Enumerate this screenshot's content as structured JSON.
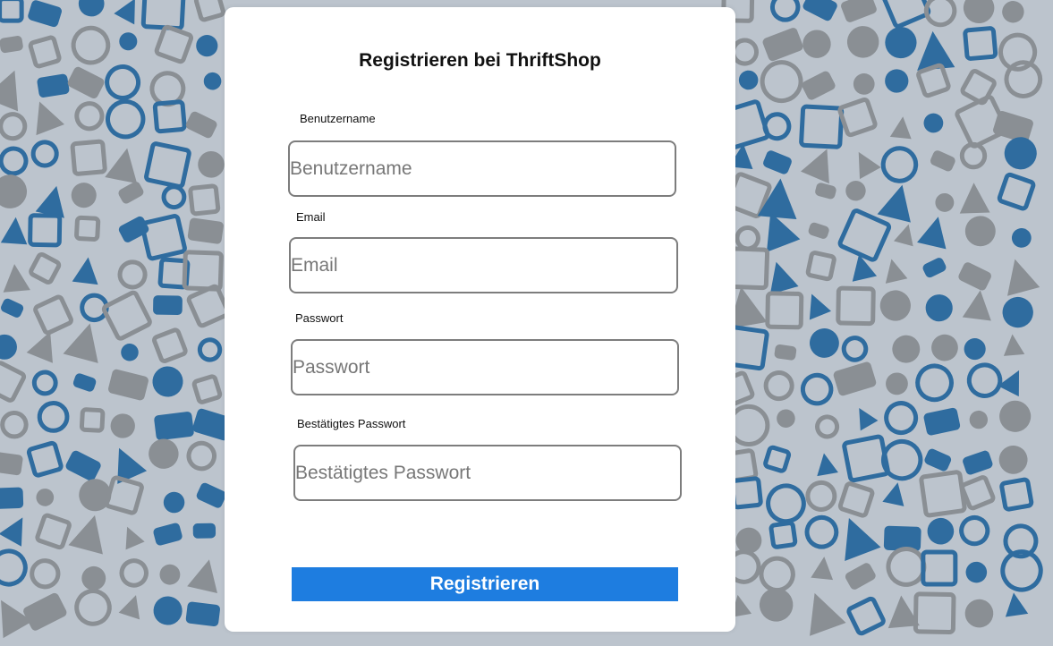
{
  "form": {
    "title": "Registrieren bei ThriftShop",
    "fields": [
      {
        "label": "Benutzername",
        "placeholder": "Benutzername",
        "value": ""
      },
      {
        "label": "Email",
        "placeholder": "Email",
        "value": ""
      },
      {
        "label": "Passwort",
        "placeholder": "Passwort",
        "value": ""
      },
      {
        "label": "Bestätigtes Passwort",
        "placeholder": "Bestätigtes Passwort",
        "value": ""
      }
    ],
    "submit_label": "Registrieren"
  },
  "colors": {
    "accent": "#1e7de0",
    "card_background": "#ffffff",
    "input_border": "#7d7d7d",
    "pattern_blue": "#2f6c9f",
    "pattern_gray": "#8a8f94"
  },
  "background": {
    "pattern_icons": [
      "shopping-cart-icon",
      "gear-icon",
      "chat-bubble-icon",
      "heart-icon",
      "clock-icon",
      "airplane-icon",
      "lightbulb-icon",
      "camera-icon",
      "envelope-icon",
      "guitar-icon",
      "cassette-icon",
      "person-icon",
      "rss-icon",
      "car-icon",
      "cloud-icon",
      "sun-icon"
    ]
  }
}
